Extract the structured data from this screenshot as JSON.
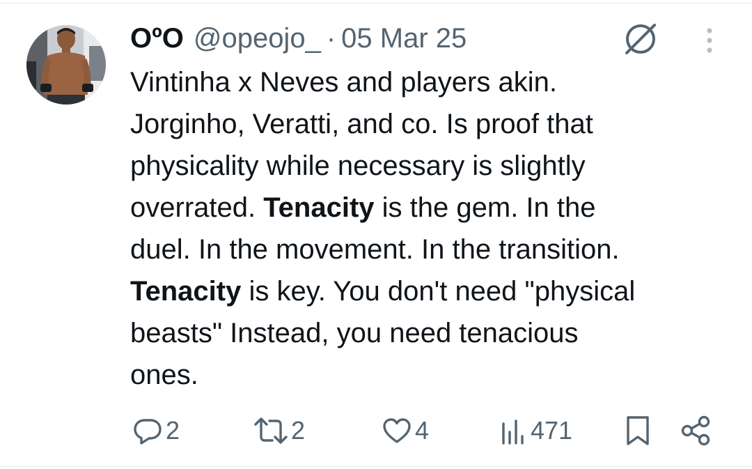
{
  "tweet": {
    "display_name": "OºO",
    "handle": "@opeojo_",
    "separator": "·",
    "date": "05 Mar 25",
    "body": {
      "l1": "Vintinha x Neves and players akin.",
      "l2": "Jorginho, Veratti, and co. Is proof that",
      "l3": "physicality while necessary is slightly",
      "l4a": "overrated. ",
      "l4b": "Tenacity",
      "l4c": " is the gem. In the",
      "l5": "duel. In the movement. In the transition.",
      "l6a": "Tenacity",
      "l6b": " is key. You don't need \"physical",
      "l7": "beasts\" Instead, you need tenacious",
      "l8": "ones."
    }
  },
  "actions": {
    "replies": "2",
    "reposts": "2",
    "likes": "4",
    "views": "471"
  },
  "icons": {
    "avatar": "profile-photo",
    "grok": "grok-icon",
    "more": "more-vertical-icon",
    "reply": "reply-icon",
    "repost": "repost-icon",
    "like": "heart-icon",
    "views": "views-chart-icon",
    "bookmark": "bookmark-icon",
    "share": "share-icon"
  },
  "colors": {
    "text_primary": "#0f1419",
    "text_secondary": "#536471",
    "divider": "#e6ecf0"
  }
}
